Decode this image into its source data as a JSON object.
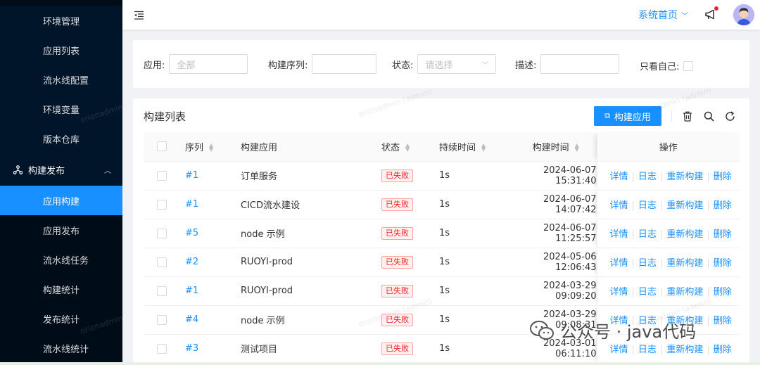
{
  "sidebar": {
    "items_top": [
      {
        "label": "环境管理"
      },
      {
        "label": "应用列表"
      },
      {
        "label": "流水线配置"
      },
      {
        "label": "环境变量"
      },
      {
        "label": "版本仓库"
      }
    ],
    "group": {
      "label": "构建发布",
      "icon": "deploy-icon"
    },
    "sub_items": [
      {
        "label": "应用构建",
        "active": true
      },
      {
        "label": "应用发布"
      },
      {
        "label": "流水线任务"
      },
      {
        "label": "构建统计"
      },
      {
        "label": "发布统计"
      },
      {
        "label": "流水线统计"
      }
    ]
  },
  "header": {
    "home_label": "系统首页",
    "accent_color": "#1890ff"
  },
  "search": {
    "app_label": "应用:",
    "app_placeholder": "全部",
    "seq_label": "构建序列:",
    "status_label": "状态:",
    "status_placeholder": "请选择",
    "desc_label": "描述:",
    "self_label": "只看自己:"
  },
  "table_panel": {
    "title": "构建列表",
    "build_button": "构建应用",
    "columns": {
      "seq": "序列",
      "app": "构建应用",
      "status": "状态",
      "duration": "持续时间",
      "build_time": "构建时间",
      "ops": "操作"
    },
    "actions": {
      "detail": "详情",
      "log": "日志",
      "rebuild": "重新构建",
      "delete": "删除"
    },
    "rows": [
      {
        "seq": "#1",
        "app": "订单服务",
        "status": "已失败",
        "duration": "1s",
        "time": "2024-06-07 15:31:40"
      },
      {
        "seq": "#1",
        "app": "CICD流水建设",
        "status": "已失败",
        "duration": "1s",
        "time": "2024-06-07 14:07:42"
      },
      {
        "seq": "#5",
        "app": "node 示例",
        "status": "已失败",
        "duration": "1s",
        "time": "2024-06-07 11:25:57"
      },
      {
        "seq": "#2",
        "app": "RUOYI-prod",
        "status": "已失败",
        "duration": "1s",
        "time": "2024-05-06 12:06:43"
      },
      {
        "seq": "#1",
        "app": "RUOYI-prod",
        "status": "已失败",
        "duration": "1s",
        "time": "2024-03-29 09:09:20"
      },
      {
        "seq": "#4",
        "app": "node 示例",
        "status": "已失败",
        "duration": "1s",
        "time": "2024-03-29 09:08:31"
      },
      {
        "seq": "#3",
        "app": "测试项目",
        "status": "已失败",
        "duration": "1s",
        "time": "2024-03-01 06:11:10"
      }
    ]
  },
  "watermark": "orionadmin (admin)",
  "overlay": {
    "text": "公众号 · java代码"
  }
}
